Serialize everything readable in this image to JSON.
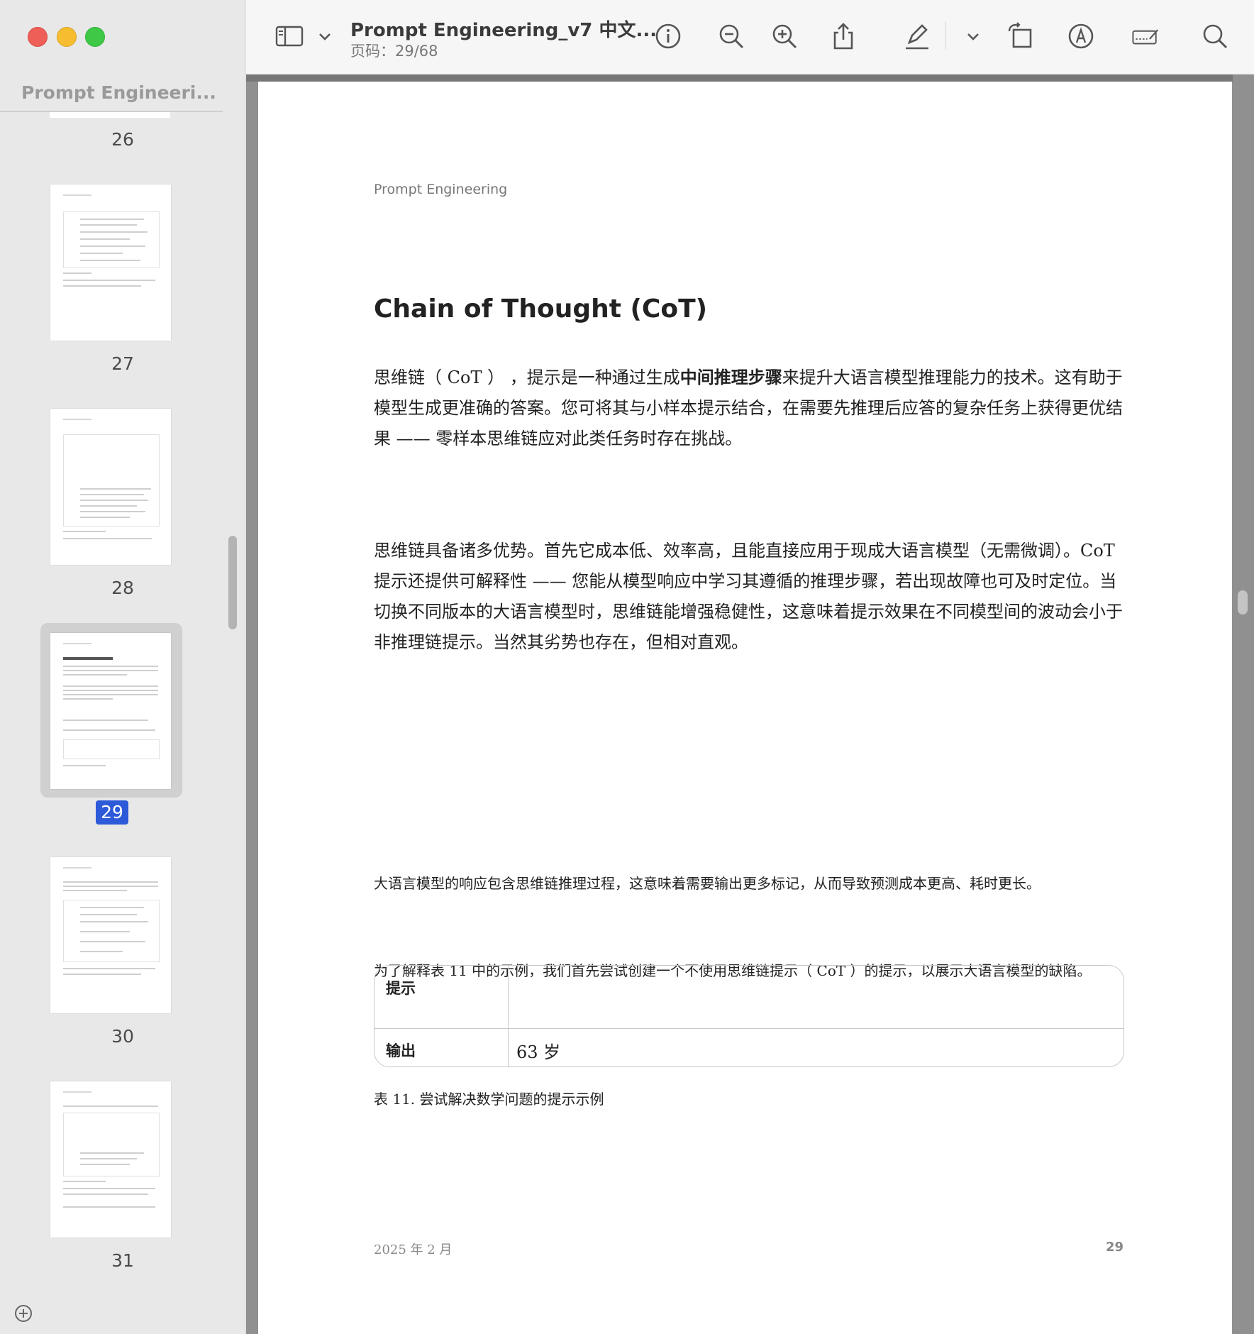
{
  "sidebar": {
    "title": "Prompt Engineeri...",
    "thumbnails": [
      {
        "page": "26"
      },
      {
        "page": "27"
      },
      {
        "page": "28"
      },
      {
        "page": "29",
        "selected": true
      },
      {
        "page": "30"
      },
      {
        "page": "31"
      }
    ]
  },
  "toolbar": {
    "doc_title": "Prompt Engineering_v7 中文...",
    "page_info": "页码：29/68",
    "icons": [
      "sidebar-toggle-icon",
      "chevron-down-icon",
      "info-icon",
      "zoom-out-icon",
      "zoom-in-icon",
      "share-icon",
      "highlight-icon",
      "chevron-down-icon",
      "rotate-icon",
      "markup-icon",
      "form-fill-icon",
      "search-icon"
    ]
  },
  "page": {
    "header": "Prompt Engineering",
    "title": "Chain of Thought (CoT)",
    "para1_a": "思维链（ CoT ） ，提示是一种通过生成",
    "para1_bold": "中间推理步骤",
    "para1_b": "来提升大语言模型推理能力的技术。这有助于模型生成更准确的答案。您可将其与小样本提示结合，在需要先推理后应答的复杂任务上获得更优结果 —— 零样本思维链应对此类任务时存在挑战。",
    "para2": "思维链具备诸多优势。首先它成本低、效率高，且能直接应用于现成大语言模型（无需微调）。CoT 提示还提供可解释性 —— 您能从模型响应中学习其遵循的推理步骤，若出现故障也可及时定位。当切换不同版本的大语言模型时，思维链能增强稳健性，这意味着提示效果在不同模型间的波动会小于非推理链提示。当然其劣势也存在，但相对直观。",
    "para3": "大语言模型的响应包含思维链推理过程，这意味着需要输出更多标记，从而导致预测成本更高、耗时更长。",
    "para4": "为了解释表 11 中的示例，我们首先尝试创建一个不使用思维链提示（ CoT ）的提示，以展示大语言模型的缺陷。",
    "table": {
      "row1_label": "提示",
      "row1_value": "",
      "row2_label": "输出",
      "row2_value": "63 岁"
    },
    "caption": "表 11. 尝试解决数学问题的提示示例",
    "footer_date": "2025 年 2 月",
    "footer_page": "29"
  },
  "colors": {
    "selection_badge": "#2d5ad8",
    "traffic_red": "#ee5f57",
    "traffic_yellow": "#f5bd2f",
    "traffic_green": "#3ec846"
  }
}
